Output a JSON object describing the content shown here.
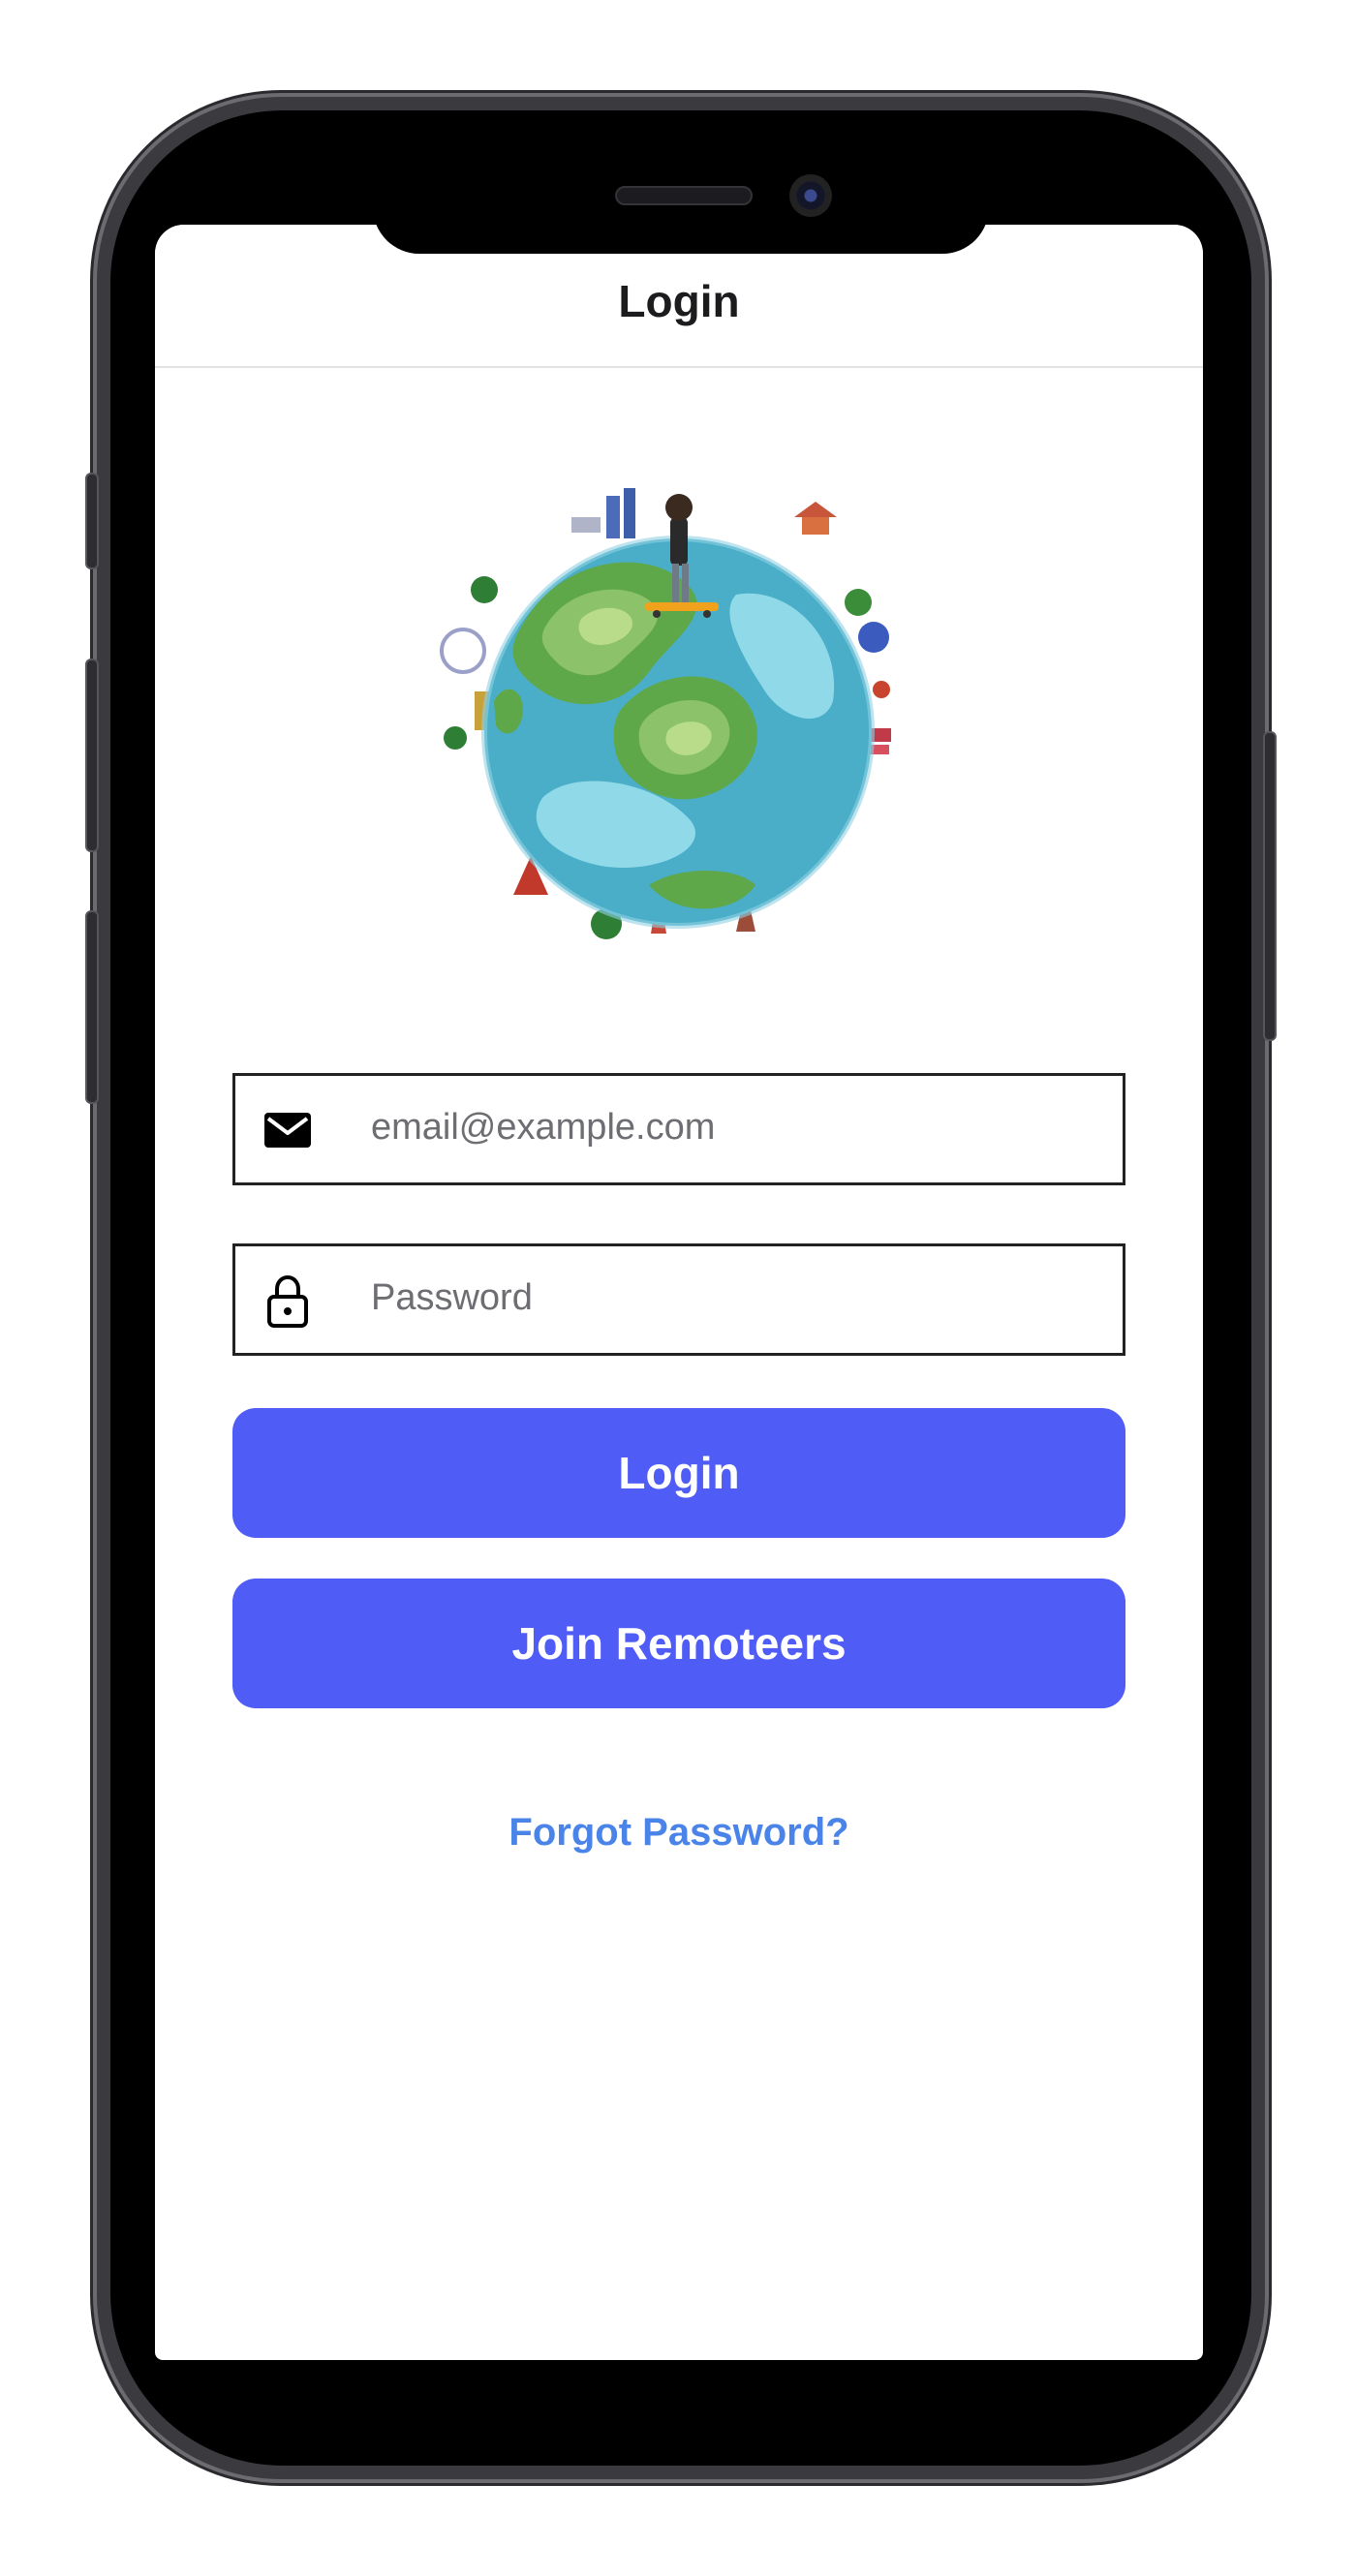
{
  "nav": {
    "title": "Login"
  },
  "email_field": {
    "placeholder": "email@example.com",
    "icon": "envelope-icon"
  },
  "password_field": {
    "placeholder": "Password",
    "icon": "lock-icon"
  },
  "buttons": {
    "login_label": "Login",
    "join_label": "Join Remoteers"
  },
  "links": {
    "forgot_password": "Forgot Password?"
  },
  "colors": {
    "primary_button": "#4f5cf5",
    "link": "#4a84e8",
    "globe_ocean": "#4aaec9",
    "globe_land": "#5fa84a"
  }
}
